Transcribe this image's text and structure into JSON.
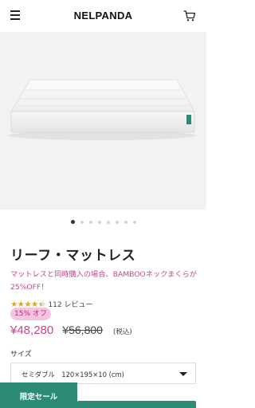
{
  "header": {
    "brand": "NELPANDA",
    "menu_icon": "hamburger-menu-icon",
    "cart_icon": "shopping-cart-icon"
  },
  "gallery": {
    "image": "mattress-product-photo",
    "total_slides": 8,
    "active_slide": 1
  },
  "product": {
    "title": "リーフ・マットレス",
    "promo": "マットレスと同時購入の場合、BAMBOOネックまくらが25%OFF！",
    "rating": 4.5,
    "review_count": "112",
    "review_label": "レビュー",
    "discount_badge": "15% オフ",
    "price_current": "¥48,280",
    "price_original": "¥56,800",
    "tax_note": "(税込)",
    "size_label": "サイズ",
    "size_selected": "セミダブル　120×195×10 (cm)"
  },
  "footer": {
    "sale_button": "限定セール"
  },
  "colors": {
    "accent_pink": "#c3498a",
    "badge_bg": "#f6c3e0",
    "brand_green": "#2c8b75",
    "star": "#e0a81c"
  }
}
